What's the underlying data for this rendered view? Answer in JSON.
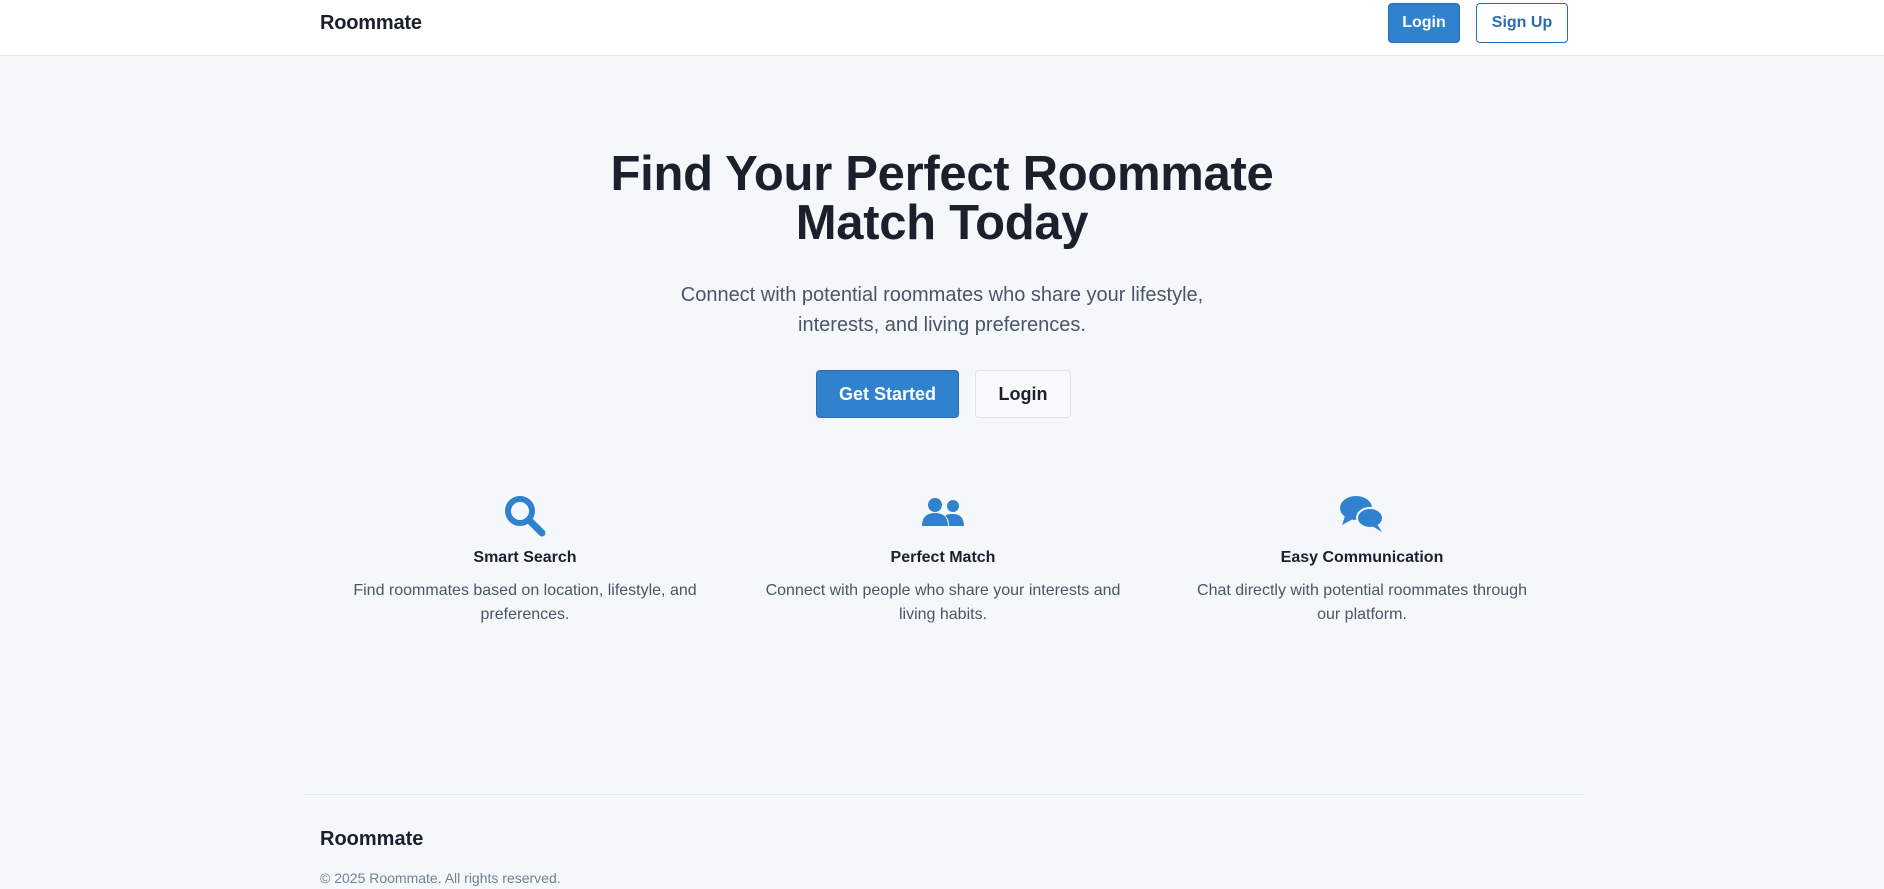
{
  "header": {
    "brand": "Roommate",
    "login_label": "Login",
    "signup_label": "Sign Up"
  },
  "hero": {
    "title_line1": "Find Your Perfect Roommate",
    "title_line2": "Match Today",
    "subtitle_line1": "Connect with potential roommates who share your lifestyle,",
    "subtitle_line2": "interests, and living preferences.",
    "primary_cta": "Get Started",
    "secondary_cta": "Login"
  },
  "features": [
    {
      "icon": "search-icon",
      "title": "Smart Search",
      "description": "Find roommates based on location, lifestyle, and preferences."
    },
    {
      "icon": "users-icon",
      "title": "Perfect Match",
      "description": "Connect with people who share your interests and living habits."
    },
    {
      "icon": "chat-icon",
      "title": "Easy Communication",
      "description": "Chat directly with potential roommates through our platform."
    }
  ],
  "footer": {
    "brand": "Roommate",
    "copyright": "© 2025 Roommate. All rights reserved."
  },
  "colors": {
    "accent": "#3182ce",
    "background": "#f5f8fb",
    "text": "#1a202c",
    "muted": "#4a5568"
  }
}
